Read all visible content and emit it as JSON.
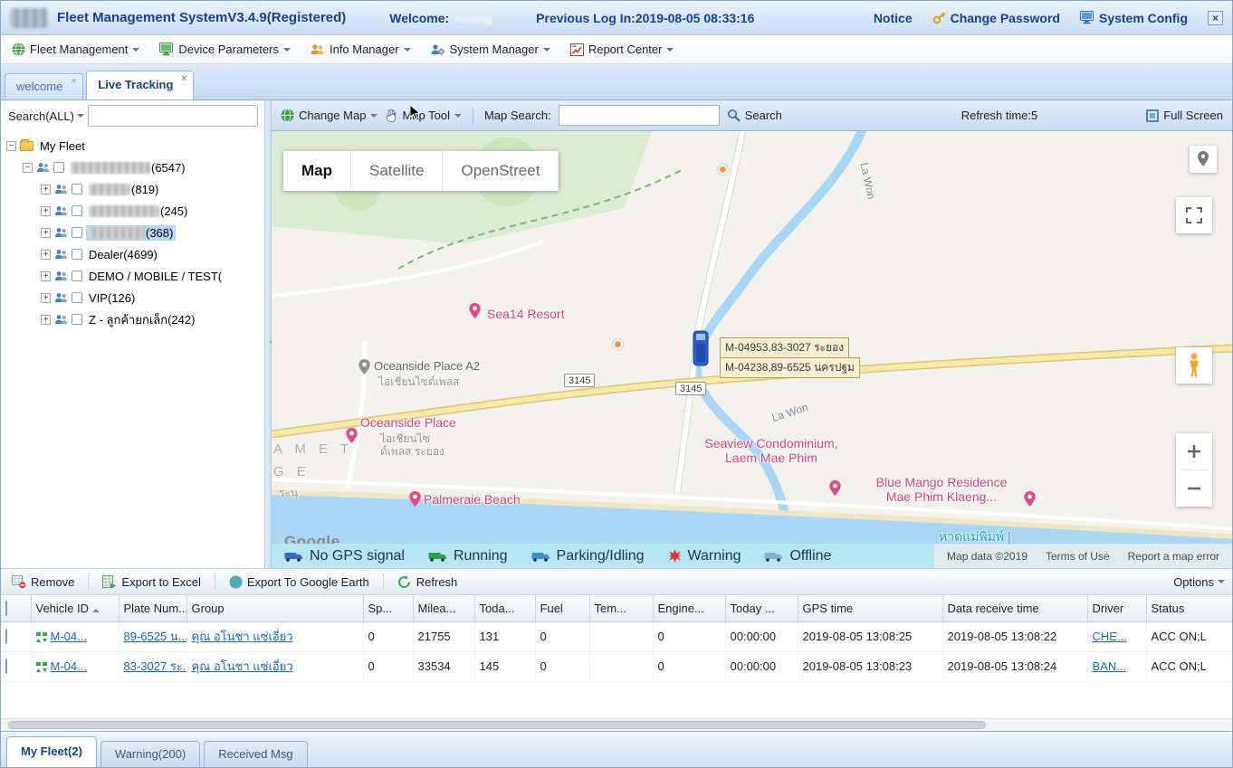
{
  "header": {
    "title": "Fleet Management SystemV3.4.9(Registered)",
    "welcome_label": "Welcome:",
    "welcome_user": "huang",
    "previous_login": "Previous Log In:2019-08-05 08:33:16",
    "notice": "Notice",
    "change_password": "Change Password",
    "system_config": "System Config"
  },
  "menubar": {
    "items": [
      {
        "label": "Fleet Management"
      },
      {
        "label": "Device Parameters"
      },
      {
        "label": "Info Manager"
      },
      {
        "label": "System Manager"
      },
      {
        "label": "Report Center"
      }
    ]
  },
  "workspace_tabs": [
    {
      "label": "welcome"
    },
    {
      "label": "Live Tracking"
    }
  ],
  "sidebar": {
    "search_label": "Search(ALL)",
    "search_value": "",
    "root_label": "My Fleet",
    "items": [
      {
        "label": "(6547)",
        "redacted": true
      },
      {
        "label": "(819)",
        "redacted": true
      },
      {
        "label": "(245)",
        "redacted": true
      },
      {
        "label": "(368)",
        "redacted": true,
        "selected": true
      },
      {
        "label": "Dealer(4699)"
      },
      {
        "label": "DEMO / MOBILE / TEST("
      },
      {
        "label": "VIP(126)"
      },
      {
        "label": "Z - ลูกค้ายกเล็ก(242)"
      }
    ]
  },
  "map_toolbar": {
    "change_map": "Change Map",
    "map_tool": "Map Tool",
    "map_search_label": "Map Search:",
    "map_search_value": "",
    "search": "Search",
    "refresh_time": "Refresh time:5",
    "full_screen": "Full Screen"
  },
  "map": {
    "modes": [
      "Map",
      "Satellite",
      "OpenStreet"
    ],
    "vehicles": [
      "M-04953,83-3027 ระยอง",
      "M-04238,89-6525 นครปฐม"
    ],
    "shield": "3145",
    "road_name": "La Won",
    "pois": {
      "sea14": "Sea14 Resort",
      "oceanside_a2": "Oceanside Place A2",
      "oceanside_a2_sub": "ไอเชี่ยนไซด์เพลส",
      "oceanside": "Oceanside Place",
      "oceanside_sub1": "ไอเชี่ยนไซ",
      "oceanside_sub2": "ด์เพลส ระยอง",
      "palmeraie": "Palmeraie Beach",
      "seaview_1": "Seaview Condominium,",
      "seaview_2": "Laem Mae Phim",
      "blue_mango_1": "Blue Mango Residence",
      "blue_mango_2": "Mae Phim Klaeng...",
      "beach": "หาดแม่พิมพ์ |",
      "frag_1": "A M E T",
      "frag_2": "G E",
      "frag_3": "ระนุ"
    },
    "legend": [
      "No GPS signal",
      "Running",
      "Parking/Idling",
      "Warning",
      "Offline"
    ],
    "attribution": {
      "map_data": "Map data ©2019",
      "terms": "Terms of Use",
      "report": "Report a map error"
    },
    "google": "Google"
  },
  "grid_toolbar": {
    "remove": "Remove",
    "export_excel": "Export to Excel",
    "export_earth": "Export To Google Earth",
    "refresh": "Refresh",
    "options": "Options"
  },
  "table": {
    "columns": [
      "Vehicle ID",
      "Plate Num...",
      "Group",
      "Sp...",
      "Milea...",
      "Toda...",
      "Fuel",
      "Tem...",
      "Engine...",
      "Today ...",
      "GPS time",
      "Data receive time",
      "Driver",
      "Status"
    ],
    "rows": [
      {
        "vehicle_id": "M-04...",
        "plate": "89-6525 น...",
        "group": "คุณ อโนชา แซ่เอี่ยว",
        "speed": "0",
        "mileage": "21755",
        "today_mileage": "131",
        "fuel": "0",
        "temp": "",
        "engine": "0",
        "today_time": "00:00:00",
        "gps_time": "2019-08-05 13:08:25",
        "data_receive_time": "2019-08-05 13:08:22",
        "driver": "CHE...",
        "status": "ACC ON;L"
      },
      {
        "vehicle_id": "M-04...",
        "plate": "83-3027 ระ...",
        "group": "คุณ อโนชา แซ่เอี่ยว",
        "speed": "0",
        "mileage": "33534",
        "today_mileage": "145",
        "fuel": "0",
        "temp": "",
        "engine": "0",
        "today_time": "00:00:00",
        "gps_time": "2019-08-05 13:08:23",
        "data_receive_time": "2019-08-05 13:08:24",
        "driver": "BAN...",
        "status": "ACC ON;L"
      }
    ]
  },
  "bottom_tabs": [
    {
      "label": "My Fleet(2)"
    },
    {
      "label": "Warning(200)"
    },
    {
      "label": "Received Msg"
    }
  ]
}
